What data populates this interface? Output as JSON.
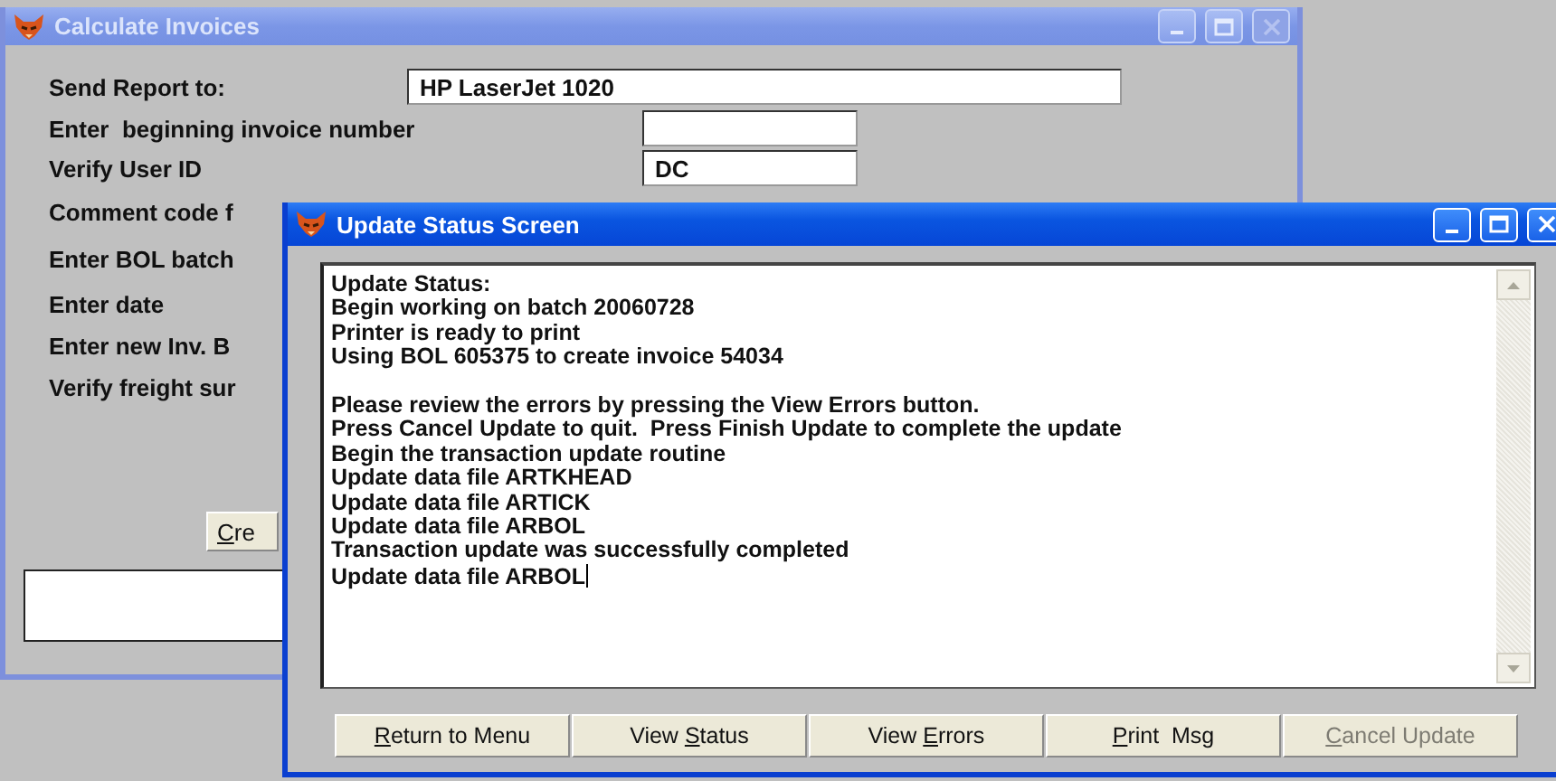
{
  "back_window": {
    "title": "Calculate Invoices",
    "active": false,
    "rows": [
      {
        "label": "Send Report to:",
        "kind": "wide",
        "value": "HP LaserJet 1020"
      },
      {
        "label": "Enter  beginning invoice number",
        "kind": "short",
        "value": ""
      },
      {
        "label": "Verify User ID",
        "kind": "short",
        "value": "DC"
      },
      {
        "label": "Comment code f",
        "kind": "none"
      },
      {
        "label": "Enter BOL batch",
        "kind": "none"
      },
      {
        "label": "Enter date",
        "kind": "none"
      },
      {
        "label": "Enter new Inv. B",
        "kind": "none"
      },
      {
        "label": "Verify freight sur",
        "kind": "none"
      }
    ],
    "button": {
      "key": "C",
      "post": "re"
    }
  },
  "front_window": {
    "title": "Update Status Screen",
    "active": true,
    "log": [
      {
        "text": "Update Status:",
        "gap_before": false
      },
      {
        "text": "Begin working on batch 20060728",
        "gap_before": false
      },
      {
        "text": "Printer is ready to print",
        "gap_before": false
      },
      {
        "text": "Using BOL 605375 to create invoice 54034",
        "gap_before": false
      },
      {
        "text": "Please review the errors by pressing the View Errors button.",
        "gap_before": true
      },
      {
        "text": "Press Cancel Update to quit.  Press Finish Update to complete the update",
        "gap_before": false
      },
      {
        "text": "Begin the transaction update routine",
        "gap_before": false
      },
      {
        "text": "Update data file ARTKHEAD",
        "gap_before": false
      },
      {
        "text": "Update data file ARTICK",
        "gap_before": false
      },
      {
        "text": "Update data file ARBOL",
        "gap_before": false
      },
      {
        "text": "Transaction update was successfully completed",
        "gap_before": false
      },
      {
        "text": "Update data file ARBOL",
        "gap_before": false
      }
    ],
    "buttons": [
      {
        "key": "R",
        "post": "eturn to Menu",
        "disabled": false
      },
      {
        "pre": "View ",
        "key": "S",
        "post": "tatus",
        "disabled": false
      },
      {
        "pre": "View ",
        "key": "E",
        "post": "rrors",
        "disabled": false
      },
      {
        "key": "P",
        "post": "rint  Msg",
        "disabled": false
      },
      {
        "key": "C",
        "post": "ancel Update",
        "disabled": true
      }
    ]
  }
}
